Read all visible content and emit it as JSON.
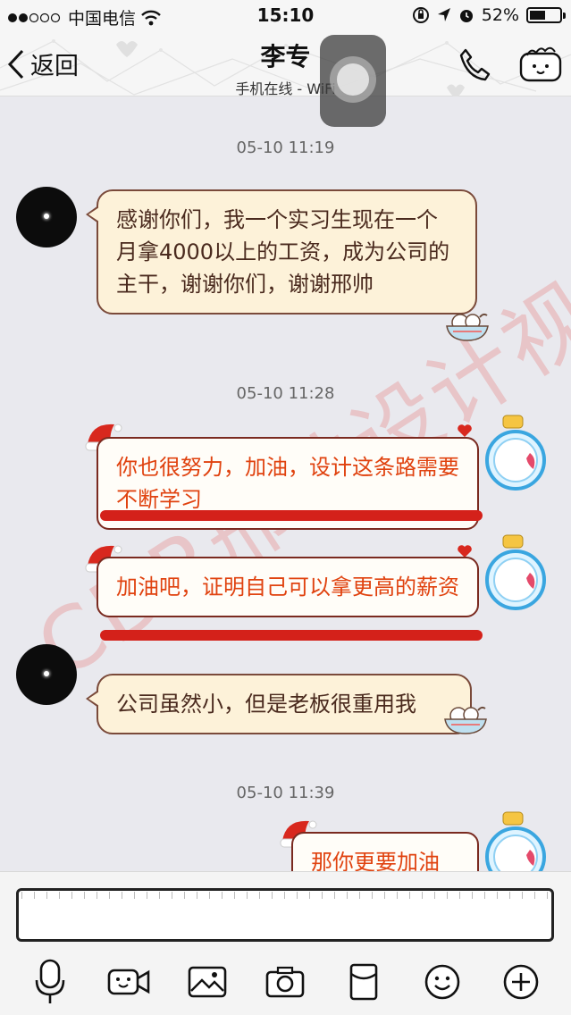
{
  "status_bar": {
    "carrier": "中国电信",
    "time": "15:10",
    "battery": "52%",
    "battery_level": 0.52
  },
  "nav": {
    "back_label": "返回",
    "title": "李专",
    "subtitle": "手机在线 - WiFi"
  },
  "messages": [
    {
      "timestamp": "05-10 11:19"
    },
    {
      "side": "in",
      "text": "感谢你们，我一个实习生现在一个月拿4000以上的工资，成为公司的主干，谢谢你们，谢谢邢帅"
    },
    {
      "timestamp": "05-10 11:28"
    },
    {
      "side": "out",
      "text": "你也很努力，加油，设计这条路需要不断学习"
    },
    {
      "side": "out",
      "text": "加油吧，证明自己可以拿更高的薪资"
    },
    {
      "side": "in",
      "text": "公司虽然小，但是老板很重用我"
    },
    {
      "timestamp": "05-10 11:39"
    },
    {
      "side": "out",
      "text": "那你更要加油"
    }
  ],
  "watermark": "CDR邢帅设计视觉团队",
  "input": {
    "value": "",
    "placeholder": ""
  },
  "toolbar": {
    "items": [
      "voice-icon",
      "video-icon",
      "image-icon",
      "camera-icon",
      "red-packet-icon",
      "emoji-icon",
      "plus-icon"
    ]
  },
  "colors": {
    "incoming_bubble": "#fdf2d9",
    "outgoing_text": "#e0420f",
    "background": "#e9e9ee"
  }
}
